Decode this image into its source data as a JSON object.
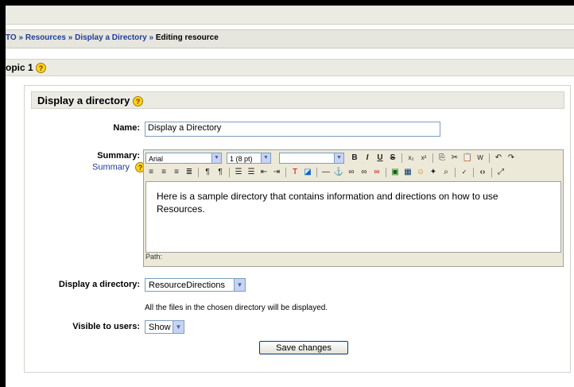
{
  "breadcrumb": {
    "prefix": "TO",
    "sep1": "»",
    "resources": "Resources",
    "sep2": "»",
    "display": "Display a Directory",
    "sep3": "»",
    "current": "Editing resource"
  },
  "topic": {
    "title": "opic 1"
  },
  "panel": {
    "title": "Display a directory"
  },
  "form": {
    "name_label": "Name:",
    "name_value": "Display a Directory",
    "summary_label": "Summary:",
    "summary_help_link": "Summary",
    "summary_text": "Here is a sample directory that contains information and directions on how to use Resources.",
    "path_label": "Path:",
    "directory_label": "Display a directory:",
    "directory_value": "ResourceDirections",
    "directory_hint": "All the files in the chosen directory will be displayed.",
    "visible_label": "Visible to users:",
    "visible_value": "Show",
    "save_label": "Save changes"
  },
  "editor_toolbar": {
    "font_family": "Arial",
    "font_size": "1 (8 pt)",
    "format": "",
    "bold": "B",
    "italic": "I",
    "underline": "U",
    "strike": "S"
  },
  "help_glyph": "?"
}
